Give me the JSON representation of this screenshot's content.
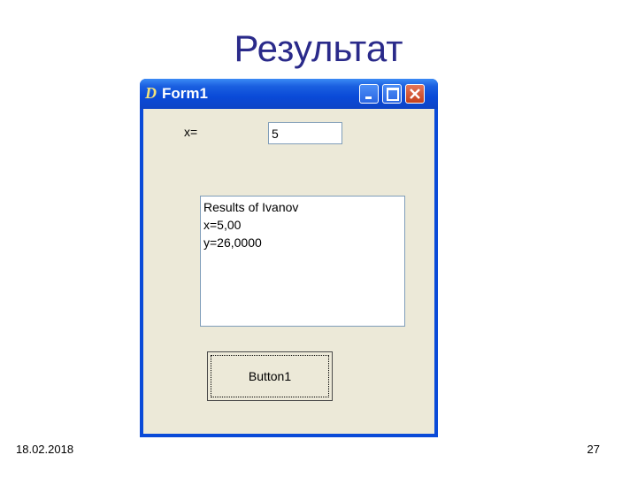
{
  "slide": {
    "title": "Результат",
    "date": "18.02.2018",
    "page_number": "27"
  },
  "window": {
    "title": "Form1",
    "icon": "delphi-app-icon",
    "icon_glyph": "D",
    "controls": [
      "minimize-icon",
      "maximize-icon",
      "close-icon"
    ]
  },
  "form": {
    "x_label": "x=",
    "x_value": "5",
    "memo_lines": [
      "Results of Ivanov",
      "x=5,00",
      "y=26,0000"
    ],
    "button_label": "Button1"
  }
}
